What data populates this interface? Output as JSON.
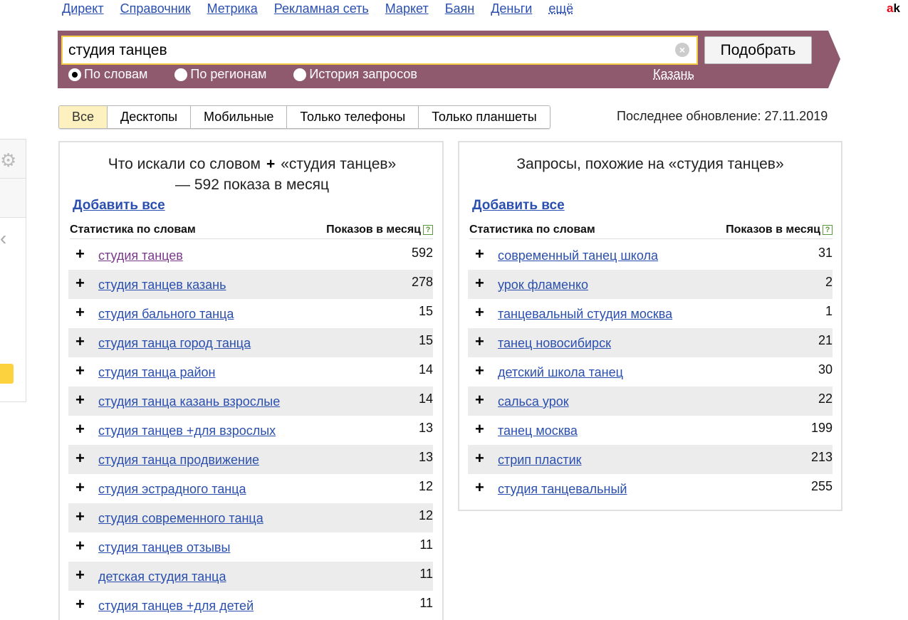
{
  "nav": {
    "links": [
      "Директ",
      "Справочник",
      "Метрика",
      "Рекламная сеть",
      "Маркет",
      "Баян",
      "Деньги"
    ],
    "more": "ещё",
    "brand_red": "a",
    "brand_rest": "k"
  },
  "search": {
    "value": "студия танцев",
    "button": "Подобрать",
    "modes": [
      "По словам",
      "По регионам",
      "История запросов"
    ],
    "region": "Казань"
  },
  "tabs": [
    "Все",
    "Десктопы",
    "Мобильные",
    "Только телефоны",
    "Только планшеты"
  ],
  "updated": "Последнее обновление: 27.11.2019",
  "left": {
    "title_a": "Что искали со словом",
    "title_plus": "+",
    "title_b": "«студия танцев» — 592 показа в месяц",
    "add_all": "Добавить все",
    "col_words": "Статистика по словам",
    "col_shows": "Показов в месяц",
    "help": "?",
    "rows": [
      {
        "phrase": "студия танцев",
        "count": "592"
      },
      {
        "phrase": "студия танцев казань",
        "count": "278"
      },
      {
        "phrase": "студия бального танца",
        "count": "15"
      },
      {
        "phrase": "студия танца город танца",
        "count": "15"
      },
      {
        "phrase": "студия танца район",
        "count": "14"
      },
      {
        "phrase": "студия танца казань взрослые",
        "count": "14"
      },
      {
        "phrase": "студия танцев +для взрослых",
        "count": "13"
      },
      {
        "phrase": "студия танца продвижение",
        "count": "13"
      },
      {
        "phrase": "студия эстрадного танца",
        "count": "12"
      },
      {
        "phrase": "студия современного танца",
        "count": "12"
      },
      {
        "phrase": "студия танцев отзывы",
        "count": "11"
      },
      {
        "phrase": "детская студия танца",
        "count": "11"
      },
      {
        "phrase": "студия танцев +для детей",
        "count": "11"
      }
    ]
  },
  "right": {
    "title": "Запросы, похожие на «студия танцев»",
    "add_all": "Добавить все",
    "col_words": "Статистика по словам",
    "col_shows": "Показов в месяц",
    "help": "?",
    "rows": [
      {
        "phrase": "современный танец школа",
        "count": "31"
      },
      {
        "phrase": "урок фламенко",
        "count": "2"
      },
      {
        "phrase": "танцевальный студия москва",
        "count": "1"
      },
      {
        "phrase": "танец новосибирск",
        "count": "21"
      },
      {
        "phrase": "детский школа танец",
        "count": "30"
      },
      {
        "phrase": "сальса урок",
        "count": "22"
      },
      {
        "phrase": "танец москва",
        "count": "199"
      },
      {
        "phrase": "стрип пластик",
        "count": "213"
      },
      {
        "phrase": "студия танцевальный",
        "count": "255"
      }
    ]
  },
  "plus_sign": "+",
  "clear_glyph": "×",
  "colors": {
    "band": "#8f5a6e",
    "link": "#2a4fae",
    "active_tab": "#fdf2bf",
    "accent_yellow": "#f5cc45"
  }
}
